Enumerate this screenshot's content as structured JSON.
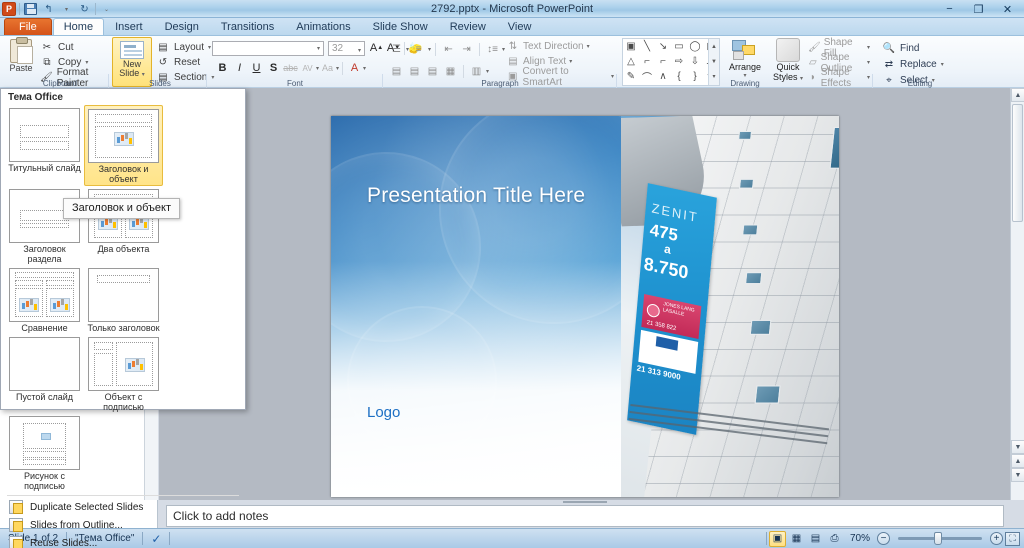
{
  "titlebar": {
    "document_title": "2792.pptx  -  Microsoft PowerPoint",
    "qat": [
      {
        "name": "app-menu",
        "glyph": "P"
      },
      {
        "name": "save",
        "glyph": ""
      },
      {
        "name": "undo",
        "glyph": "↰"
      },
      {
        "name": "undo-more",
        "glyph": "▾"
      },
      {
        "name": "redo",
        "glyph": "↻"
      },
      {
        "name": "customize-qat",
        "glyph": "⌄"
      }
    ],
    "window_buttons": {
      "minimize": "−",
      "restore": "❐",
      "close": "✕"
    }
  },
  "ribbon": {
    "tabs": [
      {
        "label": "File",
        "active": false,
        "file": true
      },
      {
        "label": "Home",
        "active": true,
        "file": false
      },
      {
        "label": "Insert",
        "active": false,
        "file": false
      },
      {
        "label": "Design",
        "active": false,
        "file": false
      },
      {
        "label": "Transitions",
        "active": false,
        "file": false
      },
      {
        "label": "Animations",
        "active": false,
        "file": false
      },
      {
        "label": "Slide Show",
        "active": false,
        "file": false
      },
      {
        "label": "Review",
        "active": false,
        "file": false
      },
      {
        "label": "View",
        "active": false,
        "file": false
      }
    ],
    "groups": {
      "clipboard": {
        "label": "Clipboard",
        "paste": "Paste",
        "cut": "Cut",
        "copy": "Copy",
        "format_painter": "Format Painter"
      },
      "slides": {
        "label": "Slides",
        "new_slide_line1": "New",
        "new_slide_line2": "Slide",
        "layout": "Layout",
        "reset": "Reset",
        "section": "Section"
      },
      "font": {
        "label": "Font",
        "font_name_value": "",
        "font_size_value": "32",
        "bold": "B",
        "italic": "I",
        "underline": "U",
        "shadow": "S",
        "strikethrough": "abc",
        "char_spacing": "AV",
        "change_case": "Aa",
        "font_color": "A",
        "grow_font": "A",
        "shrink_font": "A",
        "clear_formatting": "clear-formatting-icon"
      },
      "paragraph": {
        "label": "Paragraph",
        "text_direction": "Text Direction",
        "align_text": "Align Text",
        "convert_to_smartart": "Convert to SmartArt"
      },
      "drawing": {
        "label": "Drawing",
        "arrange": "Arrange",
        "quick_styles_line1": "Quick",
        "quick_styles_line2": "Styles",
        "shape_fill": "Shape Fill",
        "shape_outline": "Shape Outline",
        "shape_effects": "Shape Effects"
      },
      "editing": {
        "label": "Editing",
        "find": "Find",
        "replace": "Replace",
        "select": "Select"
      }
    }
  },
  "layout_gallery": {
    "heading": "Тема Office",
    "layouts": [
      {
        "label": "Титульный слайд",
        "selected": false,
        "kind": "title"
      },
      {
        "label": "Заголовок и объект",
        "selected": true,
        "kind": "title-content"
      },
      {
        "label": "Заголовок раздела",
        "selected": false,
        "kind": "section"
      },
      {
        "label": "Два объекта",
        "selected": false,
        "kind": "two-content"
      },
      {
        "label": "Сравнение",
        "selected": false,
        "kind": "comparison"
      },
      {
        "label": "Только заголовок",
        "selected": false,
        "kind": "title-only"
      },
      {
        "label": "Пустой слайд",
        "selected": false,
        "kind": "blank"
      },
      {
        "label": "Объект с подписью",
        "selected": false,
        "kind": "content-caption"
      },
      {
        "label": "Рисунок с подписью",
        "selected": false,
        "kind": "picture-caption"
      }
    ],
    "commands": [
      {
        "label": "Duplicate Selected Slides"
      },
      {
        "label": "Slides from Outline..."
      },
      {
        "label": "Reuse Slides..."
      }
    ],
    "tooltip": "Заголовок и объект"
  },
  "slide": {
    "title": "Presentation Title Here",
    "logo": "Logo",
    "banner": {
      "brand": "ZENIT",
      "number_1": "475",
      "conjunction": "a",
      "number_2": "8.750",
      "agency": "JONES LANG LASALLE",
      "phone_1": "21 358 822",
      "phone_2": "21 313 9000"
    }
  },
  "notes": {
    "placeholder": "Click to add notes"
  },
  "status": {
    "slide_counter": "Slide 1 of 2",
    "theme_name": "\"Тема Office\"",
    "spellcheck": "spellcheck-icon",
    "zoom_level": "70%",
    "views": [
      {
        "name": "normal-view",
        "glyph": "▣",
        "active": true
      },
      {
        "name": "slide-sorter-view",
        "glyph": "▦",
        "active": false
      },
      {
        "name": "reading-view",
        "glyph": "▤",
        "active": false
      },
      {
        "name": "slide-show-view",
        "glyph": "⎙",
        "active": false
      }
    ],
    "zoom_out": "−",
    "zoom_in": "+",
    "fit_to_window": "⛶"
  },
  "colors": {
    "accent_orange": "#d4531a",
    "highlight_yellow": "#ffe489",
    "title_blue": "#1c6fc4",
    "ribbon_blue": "#aed2ec"
  }
}
